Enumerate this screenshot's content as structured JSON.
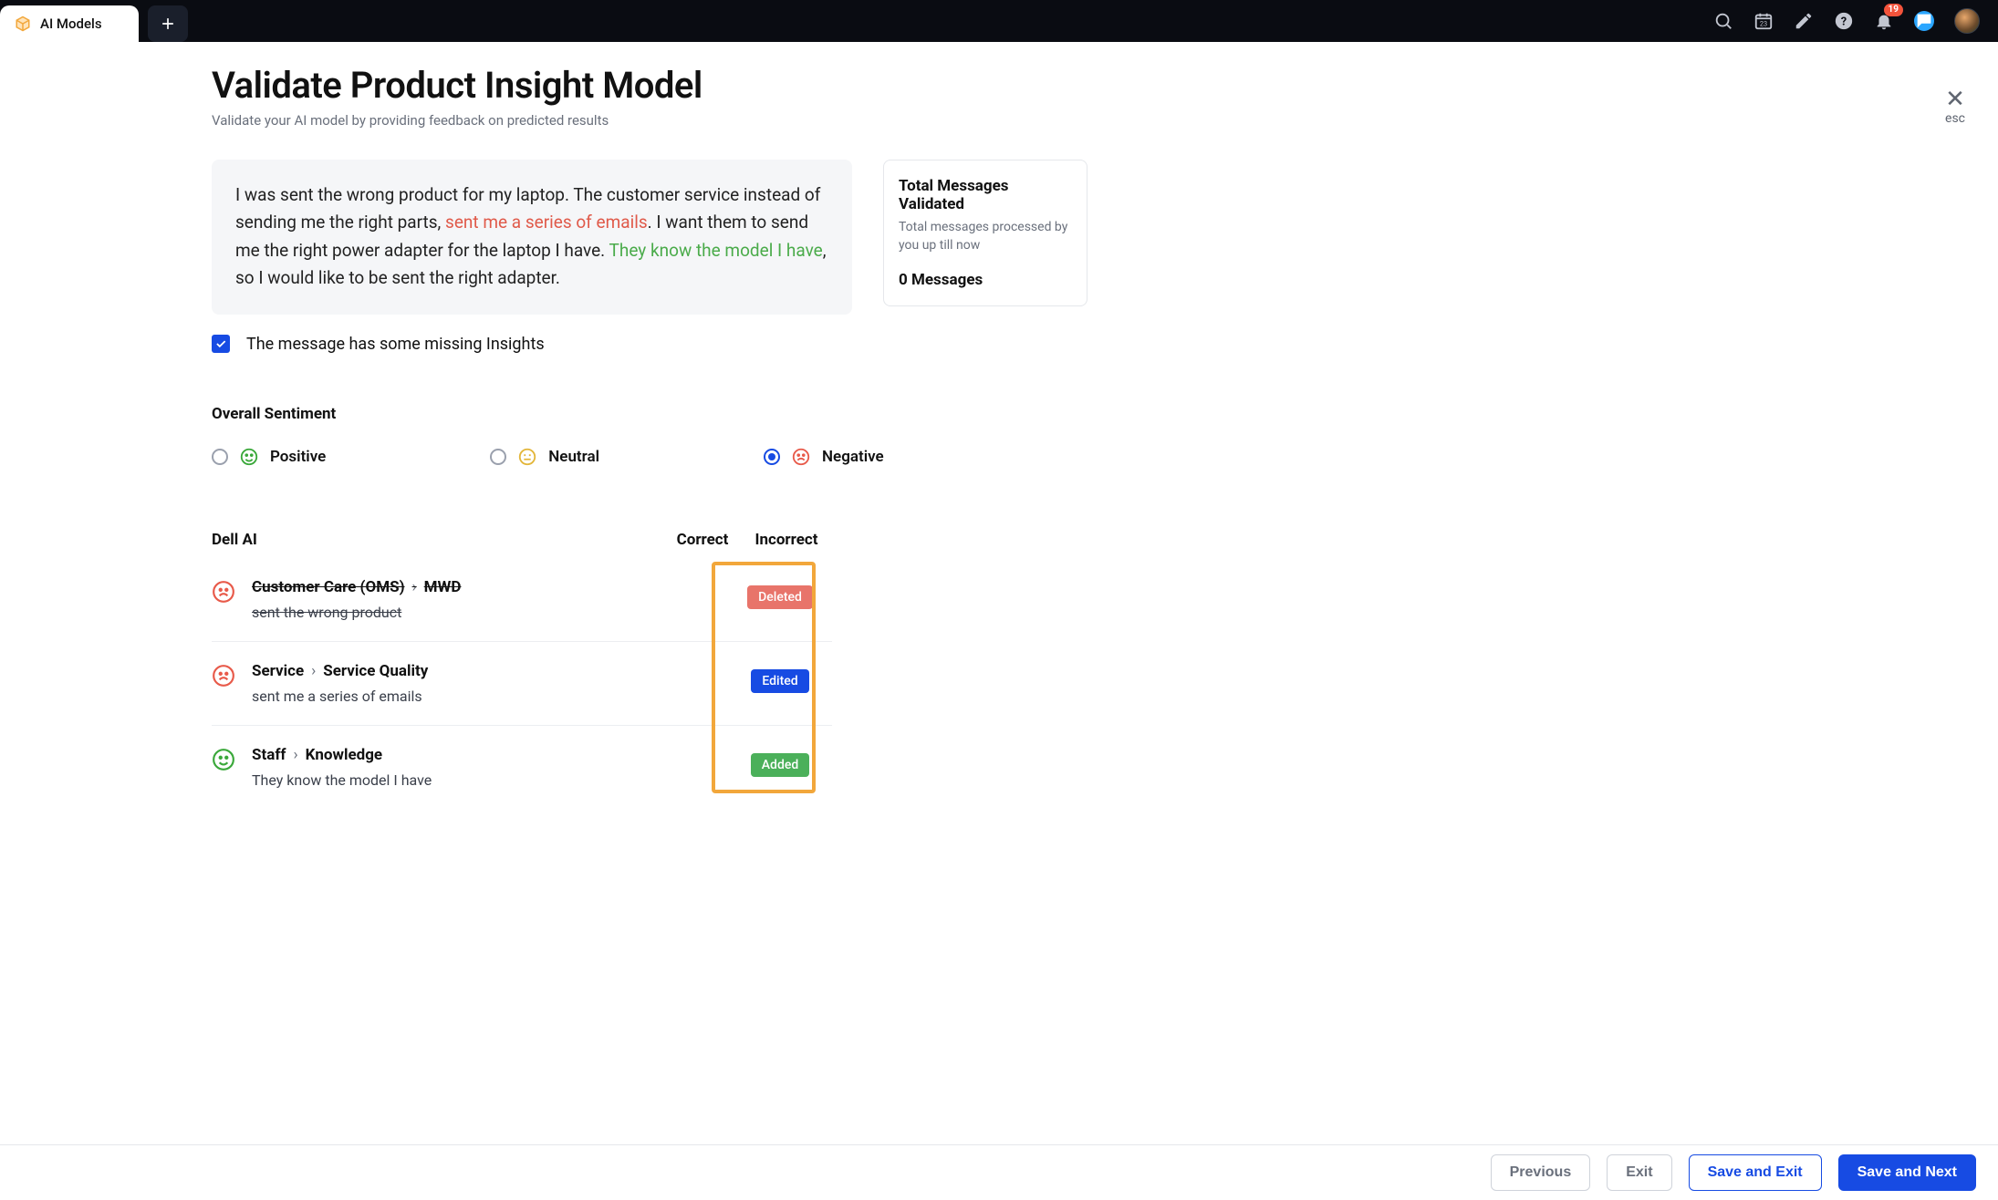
{
  "topbar": {
    "tab_label": "AI Models",
    "notification_count": "19"
  },
  "header": {
    "title": "Validate Product Insight Model",
    "subtitle": "Validate your AI model by providing feedback on predicted results",
    "close_label": "esc"
  },
  "message": {
    "seg1": "I was sent the wrong product for my laptop. The customer service instead of sending me the right parts, ",
    "hl_red": "sent me a series of emails",
    "seg2": ". I want them to send me the right power adapter for the laptop I have. ",
    "hl_green": "They know the model I have",
    "seg3": ", so I would like to be sent the right adapter."
  },
  "stats": {
    "title": "Total Messages Validated",
    "subtitle": "Total messages processed by you up till now",
    "value": "0 Messages"
  },
  "missing": {
    "label": "The message has some missing Insights"
  },
  "sentiment": {
    "heading": "Overall Sentiment",
    "options": {
      "positive": "Positive",
      "neutral": "Neutral",
      "negative": "Negative"
    },
    "selected": "negative"
  },
  "dell": {
    "heading": "Dell AI",
    "col_correct": "Correct",
    "col_incorrect": "Incorrect"
  },
  "insights": [
    {
      "sentiment": "negative",
      "path_a": "Customer Care (OMS)",
      "path_b": "MWD",
      "text": "sent the wrong product",
      "status": "Deleted",
      "strike": true
    },
    {
      "sentiment": "negative",
      "path_a": "Service",
      "path_b": "Service Quality",
      "text": "sent me a series of emails",
      "status": "Edited",
      "strike": false
    },
    {
      "sentiment": "positive",
      "path_a": "Staff",
      "path_b": "Knowledge",
      "text": "They know the model I have",
      "status": "Added",
      "strike": false
    }
  ],
  "footer": {
    "previous": "Previous",
    "exit": "Exit",
    "save_exit": "Save and Exit",
    "save_next": "Save and Next"
  },
  "colors": {
    "accent_blue": "#174be3",
    "highlight_orange": "#f2a73b",
    "chip_deleted": "#e8746a",
    "chip_added": "#4bb05a"
  }
}
